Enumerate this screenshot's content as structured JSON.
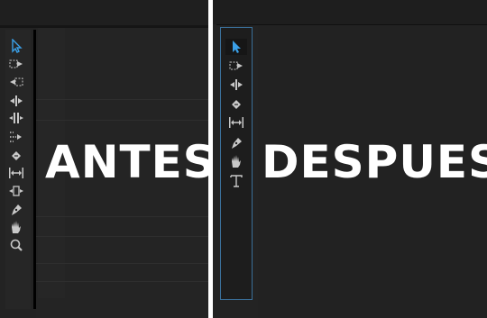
{
  "labels": {
    "before": "ANTES",
    "after": "DESPUES"
  },
  "before_toolbar": {
    "tools": [
      {
        "name": "selection-tool",
        "icon": "arrow-select-icon",
        "active": true
      },
      {
        "name": "track-select-forward-tool",
        "icon": "track-forward-icon"
      },
      {
        "name": "track-select-backward-tool",
        "icon": "track-backward-icon"
      },
      {
        "name": "ripple-edit-tool",
        "icon": "ripple-edit-icon"
      },
      {
        "name": "rolling-edit-tool",
        "icon": "rolling-edit-icon"
      },
      {
        "name": "rate-stretch-tool",
        "icon": "rate-stretch-icon"
      },
      {
        "name": "razor-tool",
        "icon": "razor-icon"
      },
      {
        "name": "slip-tool",
        "icon": "slip-icon"
      },
      {
        "name": "slide-tool",
        "icon": "slide-icon"
      },
      {
        "name": "pen-tool",
        "icon": "pen-icon"
      },
      {
        "name": "hand-tool",
        "icon": "hand-icon"
      },
      {
        "name": "zoom-tool",
        "icon": "zoom-icon"
      }
    ]
  },
  "after_toolbar": {
    "tools": [
      {
        "name": "selection-tool",
        "icon": "arrow-select-icon",
        "active": true
      },
      {
        "name": "track-select-tool",
        "icon": "track-forward-icon"
      },
      {
        "name": "ripple-edit-tool",
        "icon": "ripple-edit-icon"
      },
      {
        "name": "razor-tool",
        "icon": "razor-icon"
      },
      {
        "name": "slip-tool",
        "icon": "slip-icon"
      },
      {
        "name": "pen-tool",
        "icon": "pen-icon"
      },
      {
        "name": "hand-tool",
        "icon": "hand-icon"
      },
      {
        "name": "type-tool",
        "icon": "type-icon"
      }
    ]
  },
  "colors": {
    "active_blue": "#3aa0e8",
    "icon_gray": "#c8c8c8",
    "frame_blue": "#3a6f99"
  }
}
